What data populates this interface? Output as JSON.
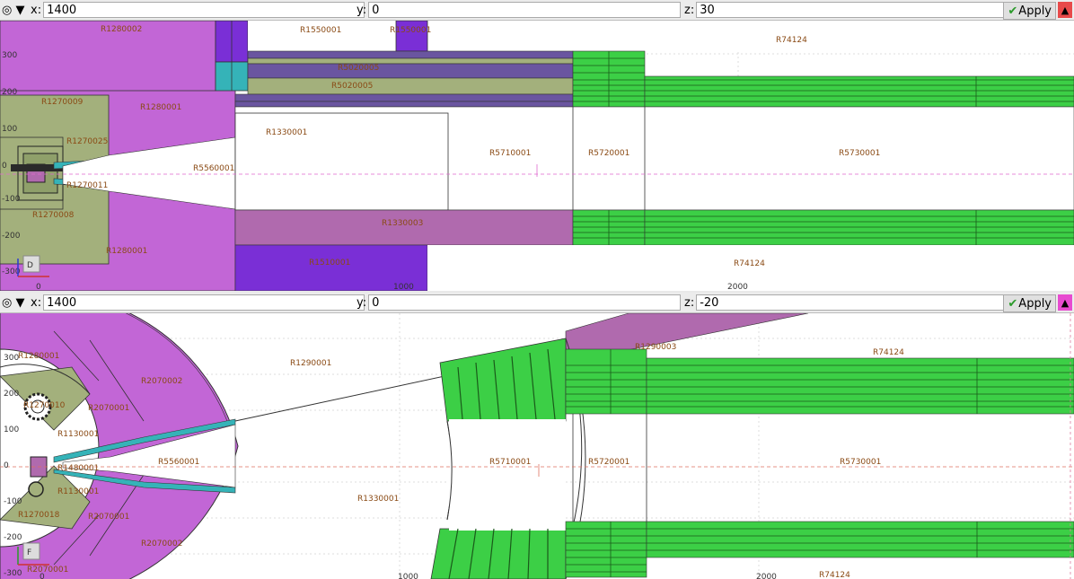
{
  "top": {
    "x_label": "x:",
    "x_value": "1400",
    "y_label": "y:",
    "y_value": "0",
    "z_label": "z:",
    "z_value": "30",
    "apply_label": "Apply",
    "mode_glyphs": "◎ ▼",
    "corner_letter": "D",
    "regions": {
      "r1280002": "R1280002",
      "r1550001": "R1550001",
      "r1550001b": "R1550001",
      "r74124a": "R74124",
      "r5020005": "R5020005",
      "r5020006": "R5020005",
      "r1270009": "R1270009",
      "r1280001": "R1280001",
      "r1270025": "R1270025",
      "r1330001": "R1330001",
      "r5710001": "R5710001",
      "r5720001": "R5720001",
      "r5730001": "R5730001",
      "r5560001": "R5560001",
      "r1270011": "R1270011",
      "r1270008": "R1270008",
      "r1330003": "R1330003",
      "r1280001b": "R1280001",
      "r74124b": "R74124",
      "r1510001": "R1510001"
    },
    "axis": {
      "y300": "300",
      "y200": "200",
      "y100": "100",
      "y0": "0",
      "ym100": "-100",
      "ym200": "-200",
      "ym300": "-300",
      "x0": "0",
      "x1000": "1000",
      "x2000": "2000"
    }
  },
  "bottom": {
    "x_label": "x:",
    "x_value": "1400",
    "y_label": "y:",
    "y_value": "0",
    "z_label": "z:",
    "z_value": "-20",
    "apply_label": "Apply",
    "mode_glyphs": "◎ ▼",
    "corner_letter": "F",
    "regions": {
      "r1280001": "R1280001",
      "r1290001": "R1290001",
      "r1290003": "R1290003",
      "r74124a": "R74124",
      "r2070002a": "R2070002",
      "r1270010": "R1270010",
      "r2070001a": "R2070001",
      "r1130001a": "R1130001",
      "r1480001": "R1480001",
      "r5560001": "R5560001",
      "r5710001": "R5710001",
      "r5720001": "R5720001",
      "r5730001": "R5730001",
      "r1130001b": "R1130001",
      "r1330001": "R1330001",
      "r1270018": "R1270018",
      "r2070001b": "R2070001",
      "r2070002b": "R2070002",
      "r74124b": "R74124",
      "r2070001c": "R2070001"
    },
    "axis": {
      "y300": "300",
      "y200": "200",
      "y100": "100",
      "y0": "0",
      "ym100": "-100",
      "ym200": "-200",
      "ym300": "-300",
      "x0": "0",
      "x1000": "1000",
      "x2000": "2000"
    }
  },
  "colors": {
    "magenta": "#c266d6",
    "dark_purple": "#7a2fd6",
    "olive": "#a3b07c",
    "green": "#3ccf46",
    "teal": "#35b3b8",
    "mauve": "#b06aae",
    "slate": "#6a55a0"
  }
}
